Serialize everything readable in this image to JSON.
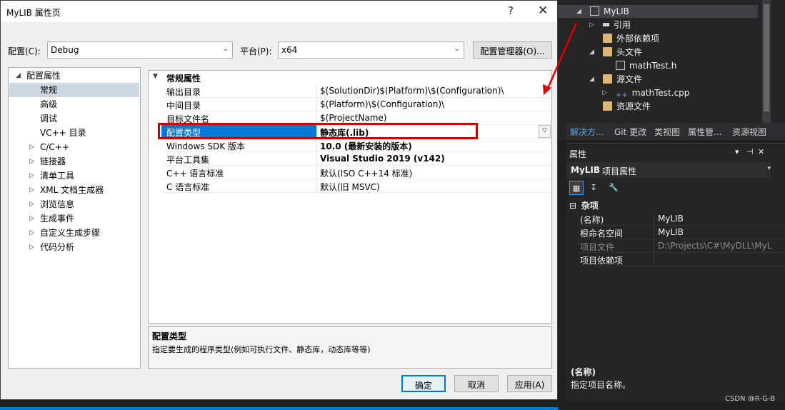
{
  "dialog": {
    "title": "MyLIB 属性页",
    "help_glyph": "?",
    "close_glyph": "✕",
    "config_label": "配置(C):",
    "config_value": "Debug",
    "platform_label": "平台(P):",
    "platform_value": "x64",
    "config_manager_button": "配置管理器(O)...",
    "tree": [
      {
        "label": "配置属性",
        "exp": "◢"
      },
      {
        "label": "常规",
        "exp": ""
      },
      {
        "label": "高级",
        "exp": ""
      },
      {
        "label": "调试",
        "exp": ""
      },
      {
        "label": "VC++ 目录",
        "exp": ""
      },
      {
        "label": "C/C++",
        "exp": "▷"
      },
      {
        "label": "链接器",
        "exp": "▷"
      },
      {
        "label": "清单工具",
        "exp": "▷"
      },
      {
        "label": "XML 文档生成器",
        "exp": "▷"
      },
      {
        "label": "浏览信息",
        "exp": "▷"
      },
      {
        "label": "生成事件",
        "exp": "▷"
      },
      {
        "label": "自定义生成步骤",
        "exp": "▷"
      },
      {
        "label": "代码分析",
        "exp": "▷"
      }
    ],
    "grid": {
      "category": "常规属性",
      "category_exp": "▼",
      "rows": [
        {
          "name": "输出目录",
          "value": "$(SolutionDir)$(Platform)\\$(Configuration)\\"
        },
        {
          "name": "中间目录",
          "value": "$(Platform)\\$(Configuration)\\"
        },
        {
          "name": "目标文件名",
          "value": "$(ProjectName)"
        },
        {
          "name": "配置类型",
          "value": "静态库(.lib)"
        },
        {
          "name": "Windows SDK 版本",
          "value": "10.0 (最新安装的版本)"
        },
        {
          "name": "平台工具集",
          "value": "Visual Studio 2019 (v142)"
        },
        {
          "name": "C++ 语言标准",
          "value": "默认(ISO C++14 标准)"
        },
        {
          "name": "C 语言标准",
          "value": "默认(旧 MSVC)"
        }
      ],
      "dropdown_glyph": "▽"
    },
    "description": {
      "title": "配置类型",
      "text": "指定要生成的程序类型(例如可执行文件、静态库，动态库等等)"
    },
    "buttons": {
      "ok": "确定",
      "cancel": "取消",
      "apply": "应用(A)"
    }
  },
  "solution_explorer": {
    "items": [
      {
        "label": "MyLIB",
        "exp": "◢",
        "icon": "project-icon"
      },
      {
        "label": "引用",
        "exp": "▷",
        "icon": "references-icon"
      },
      {
        "label": "外部依赖项",
        "exp": "",
        "icon": "external-deps-icon"
      },
      {
        "label": "头文件",
        "exp": "◢",
        "icon": "folder-icon"
      },
      {
        "label": "mathTest.h",
        "exp": "",
        "icon": "header-file-icon"
      },
      {
        "label": "源文件",
        "exp": "◢",
        "icon": "folder-icon"
      },
      {
        "label": "mathTest.cpp",
        "exp": "▷",
        "icon": "cpp-file-icon"
      },
      {
        "label": "资源文件",
        "exp": "",
        "icon": "folder-icon"
      }
    ],
    "tabs": [
      "解决方...",
      "Git 更改",
      "类视图",
      "属性管...",
      "资源视图"
    ]
  },
  "properties": {
    "header": "属性",
    "header_buttons": [
      "▾",
      "⊣",
      "✕"
    ],
    "object_name": "MyLIB",
    "object_kind": "项目属性",
    "tools": [
      "▦",
      "↧",
      "🔧"
    ],
    "category_exp": "⊟",
    "category": "杂项",
    "rows": [
      {
        "name": "(名称)",
        "value": "MyLIB"
      },
      {
        "name": "根命名空间",
        "value": "MyLIB"
      },
      {
        "name": "项目文件",
        "value": "D:\\Projects\\C#\\MyDLL\\MyL"
      },
      {
        "name": "项目依赖项",
        "value": ""
      }
    ],
    "desc_title": "(名称)",
    "desc_text": "指定项目名称。"
  },
  "watermark": "CSDN @R-G-B",
  "colors": {
    "highlight_box": "#d10000",
    "selection": "#0078d7",
    "arrow": "#e00000"
  }
}
